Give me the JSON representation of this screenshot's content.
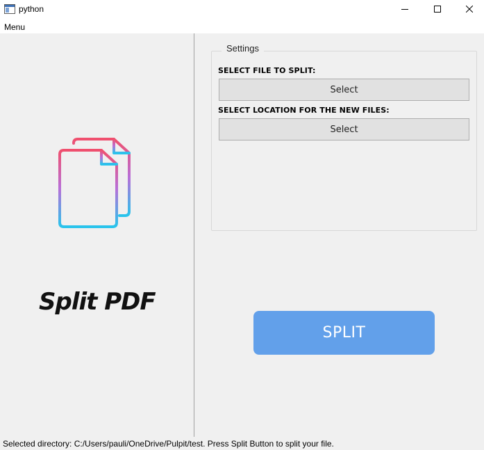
{
  "window": {
    "title": "python",
    "app_icon": "python-window-icon",
    "controls": [
      "minimize-icon",
      "maximize-icon",
      "close-icon"
    ]
  },
  "menubar": {
    "items": [
      {
        "label": "Menu"
      }
    ]
  },
  "left_panel": {
    "logo_icon": "documents-icon",
    "logo_text": "Split PDF"
  },
  "settings": {
    "title": "Settings",
    "file_label": "SELECT FILE TO SPLIT:",
    "file_button": "Select",
    "location_label": "SELECT LOCATION FOR THE NEW FILES:",
    "location_button": "Select"
  },
  "split_button": "SPLIT",
  "statusbar": {
    "text": "Selected directory: C:/Users/pauli/OneDrive/Pulpit/test. Press Split Button to split your file."
  },
  "colors": {
    "split_button_bg": "#62a0ea",
    "logo_gradient_top": "#f0506e",
    "logo_gradient_mid": "#b86fd8",
    "logo_gradient_bottom": "#28c4ec"
  }
}
